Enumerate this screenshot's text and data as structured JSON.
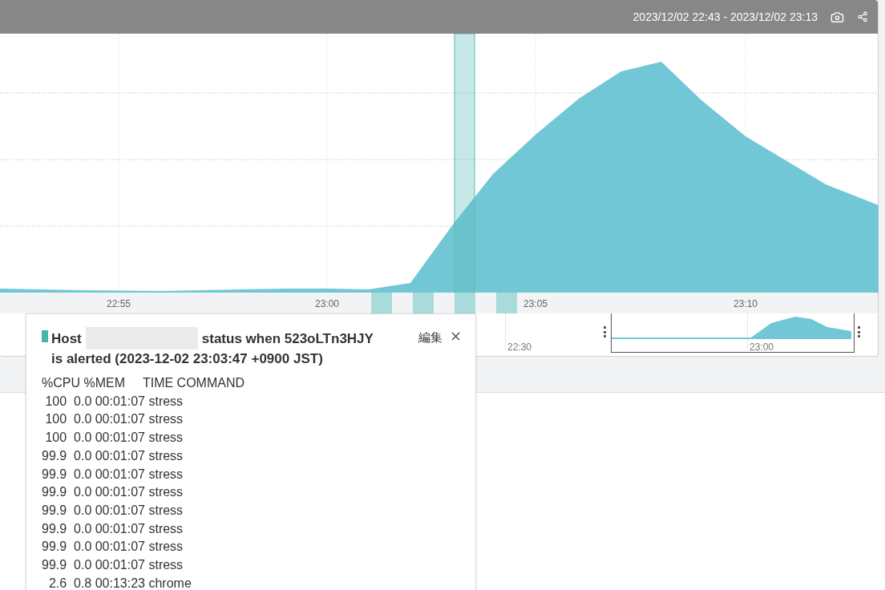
{
  "header": {
    "time_range": "2023/12/02 22:43 - 2023/12/02 23:13"
  },
  "main_chart": {
    "x_labels": [
      "22:55",
      "23:00",
      "23:05",
      "23:10"
    ]
  },
  "overview": {
    "x_labels": [
      "22:30",
      "23:00"
    ]
  },
  "popup": {
    "title_before": "Host",
    "title_after": "status when 523oLTn3HJY",
    "title_line2": "is alerted (2023-12-02 23:03:47 +0900 JST)",
    "edit": "編集",
    "lines": [
      "%CPU %MEM     TIME COMMAND",
      " 100  0.0 00:01:07 stress",
      " 100  0.0 00:01:07 stress",
      " 100  0.0 00:01:07 stress",
      "99.9  0.0 00:01:07 stress",
      "99.9  0.0 00:01:07 stress",
      "99.9  0.0 00:01:07 stress",
      "99.9  0.0 00:01:07 stress",
      "99.9  0.0 00:01:07 stress",
      "99.9  0.0 00:01:07 stress",
      "99.9  0.0 00:01:07 stress",
      "  2.6  0.8 00:13:23 chrome"
    ]
  }
}
